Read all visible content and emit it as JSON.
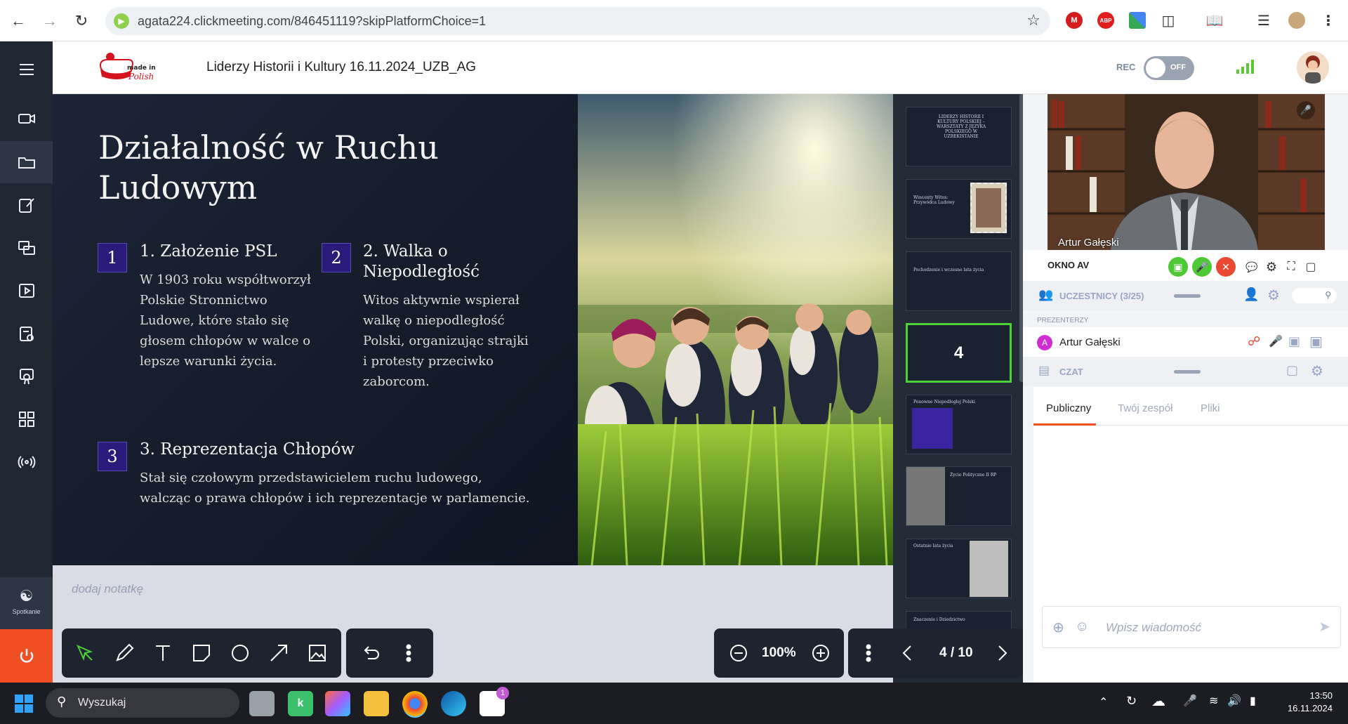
{
  "browser": {
    "url": "agata224.clickmeeting.com/846451119?skipPlatformChoice=1",
    "extensions": [
      "M",
      "ABP"
    ]
  },
  "header": {
    "logo_text": "made in Polish",
    "meeting_title": "Liderzy Historii i Kultury 16.11.2024_UZB_AG",
    "rec_label": "REC",
    "rec_toggle": "OFF"
  },
  "rail": {
    "spotkanie_label": "Spotkanie"
  },
  "slide": {
    "title": "Działalność w Ruchu Ludowym",
    "points": [
      {
        "num": "1",
        "title": "1. Założenie PSL",
        "text": "W 1903 roku współtworzył Polskie Stronnictwo Ludowe, które stało się głosem chłopów w walce o lepsze warunki życia."
      },
      {
        "num": "2",
        "title": "2. Walka o Niepodległość",
        "text": "Witos aktywnie wspierał walkę o niepodległość Polski, organizując strajki i protesty przeciwko zaborcom."
      },
      {
        "num": "3",
        "title": "3. Reprezentacja Chłopów",
        "text": "Stał się czołowym przedstawicielem ruchu ludowego, walcząc o prawa chłopów i ich reprezentacje w parlamencie."
      }
    ]
  },
  "notes": {
    "placeholder": "dodaj notatkę"
  },
  "thumbnails": [
    {
      "label": "LIDERZY HISTORII I KULTURY POLSKIEJ – WARSZTATY Z JĘZYKA POLSKIEGO W UZBEKISTANIE"
    },
    {
      "label": "Wincenty Witos: Przywódca Ludowy"
    },
    {
      "label": "Pochodzenie i wczesne lata życia"
    },
    {
      "label": "4"
    },
    {
      "label": "Ponowne Niepodległej Polski"
    },
    {
      "label": "Życie Polityczne II RP"
    },
    {
      "label": "Ostatnie lata życia"
    },
    {
      "label": "Znaczenie i Dziedzictwo"
    }
  ],
  "toolbar": {
    "zoom": "100%",
    "page": "4 / 10"
  },
  "rightpanel": {
    "video_name": "Artur Gałęski",
    "okno_av": "OKNO AV",
    "participants_label": "UCZESTNICY (3/25)",
    "presenters_label": "PREZENTERZY",
    "presenter_initial": "A",
    "presenter_name": "Artur Gałęski",
    "chat_label": "CZAT",
    "chat_tabs": [
      "Publiczny",
      "Twój zespół",
      "Pliki"
    ],
    "message_placeholder": "Wpisz wiadomość"
  },
  "taskbar": {
    "search_label": "Wyszukaj",
    "store_badge": "1",
    "time": "13:50",
    "date": "16.11.2024"
  }
}
